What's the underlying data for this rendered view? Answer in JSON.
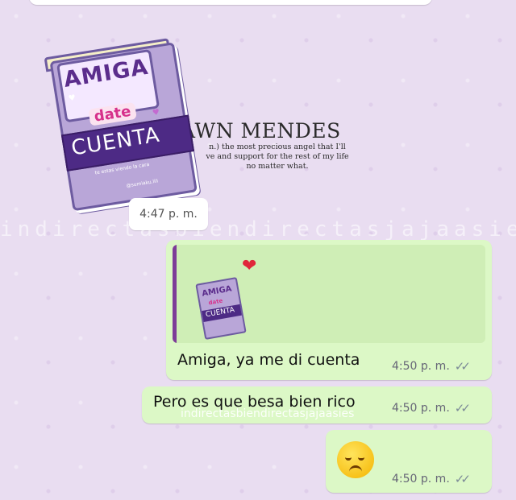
{
  "sticker": {
    "book_title_top": "AMIGA",
    "book_title_mid": "date",
    "book_title_bottom": "CUENTA",
    "book_small_text": "te estas viendo la cara",
    "book_credit": "@sumiaku.lili",
    "background_title": "AWN MENDES",
    "background_line1": "n.) the most precious angel that I'll",
    "background_line2": "ve and support for the rest of my life",
    "background_line3": "no matter what."
  },
  "sticker_time": "4:47 p. m.",
  "watermark_text": "indirectasbiendirectasjajaasies",
  "messages": [
    {
      "quoted_heart_icon": "red-heart-icon",
      "quoted_sticker": {
        "top": "AMIGA",
        "mid": "date",
        "bottom": "CUENTA"
      },
      "text": "Amiga, ya me di cuenta",
      "time": "4:50 p. m.",
      "status_icon": "double-check-icon"
    },
    {
      "text": "Pero es que besa bien rico",
      "watermark": "indirectasbiendirectasjajaasies",
      "time": "4:50 p. m.",
      "status_icon": "double-check-icon"
    },
    {
      "emoji": "disappointed-face-icon",
      "time": "4:50 p. m.",
      "status_icon": "double-check-icon"
    }
  ],
  "colors": {
    "outgoing_bubble": "#dcf8c6",
    "incoming_bubble": "#ffffff",
    "chat_background": "#e9ddf1",
    "quote_bar": "#7d3c98"
  }
}
